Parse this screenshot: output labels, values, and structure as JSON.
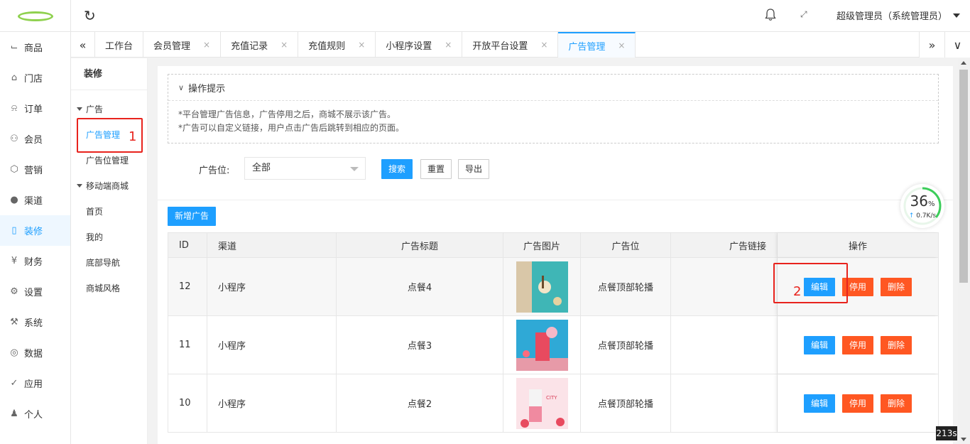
{
  "topbar": {
    "user_label": "超级管理员（系统管理员）"
  },
  "sidebar": {
    "items": [
      {
        "label": "商品",
        "icon": "cart-icon"
      },
      {
        "label": "门店",
        "icon": "home-icon"
      },
      {
        "label": "订单",
        "icon": "bell-icon"
      },
      {
        "label": "会员",
        "icon": "user-icon"
      },
      {
        "label": "营销",
        "icon": "cube-icon"
      },
      {
        "label": "渠道",
        "icon": "circle-icon"
      },
      {
        "label": "装修",
        "icon": "tablet-icon"
      },
      {
        "label": "财务",
        "icon": "yen-icon"
      },
      {
        "label": "设置",
        "icon": "gear-icon"
      },
      {
        "label": "系统",
        "icon": "tools-icon"
      },
      {
        "label": "数据",
        "icon": "globe-icon"
      },
      {
        "label": "应用",
        "icon": "check-circle-icon"
      },
      {
        "label": "个人",
        "icon": "person-icon"
      }
    ],
    "active_index": 6
  },
  "tabs": [
    {
      "label": "工作台",
      "closable": false
    },
    {
      "label": "会员管理",
      "closable": true
    },
    {
      "label": "充值记录",
      "closable": true
    },
    {
      "label": "充值规则",
      "closable": true
    },
    {
      "label": "小程序设置",
      "closable": true
    },
    {
      "label": "开放平台设置",
      "closable": true
    },
    {
      "label": "广告管理",
      "closable": true,
      "active": true
    }
  ],
  "subside": {
    "title": "装修",
    "group1": "广告",
    "item_ad_manage": "广告管理",
    "item_ad_position": "广告位管理",
    "group2": "移动端商城",
    "item_home": "首页",
    "item_mine": "我的",
    "item_bottom_nav": "底部导航",
    "item_style": "商城风格"
  },
  "tips": {
    "title": "操作提示",
    "line1": "*平台管理广告信息，广告停用之后，商城不展示该广告。",
    "line2": "*广告可以自定义链接，用户点击广告后跳转到相应的页面。"
  },
  "filter": {
    "label": "广告位:",
    "select_value": "全部",
    "search": "搜索",
    "reset": "重置",
    "export": "导出"
  },
  "add_button": "新增广告",
  "table": {
    "headers": [
      "ID",
      "渠道",
      "广告标题",
      "广告图片",
      "广告位",
      "广告链接",
      "操作"
    ],
    "rows": [
      {
        "id": "12",
        "channel": "小程序",
        "title": "点餐4",
        "position": "点餐顶部轮播",
        "link": "",
        "thumb": "thumb-teal"
      },
      {
        "id": "11",
        "channel": "小程序",
        "title": "点餐3",
        "position": "点餐顶部轮播",
        "link": "",
        "thumb": "thumb-blue"
      },
      {
        "id": "10",
        "channel": "小程序",
        "title": "点餐2",
        "position": "点餐顶部轮播",
        "link": "",
        "thumb": "thumb-pink"
      }
    ],
    "op_edit": "编辑",
    "op_disable": "停用",
    "op_delete": "删除"
  },
  "annotations": {
    "num1": "1",
    "num2": "2",
    "color": "#e8231d"
  },
  "speed_widget": {
    "percent": "36",
    "percent_unit": "%",
    "rate": "0.7K/s"
  },
  "timer": "213s",
  "colors": {
    "primary": "#1e9fff",
    "warn": "#ff5722",
    "logo_green": "#8fd14f"
  }
}
